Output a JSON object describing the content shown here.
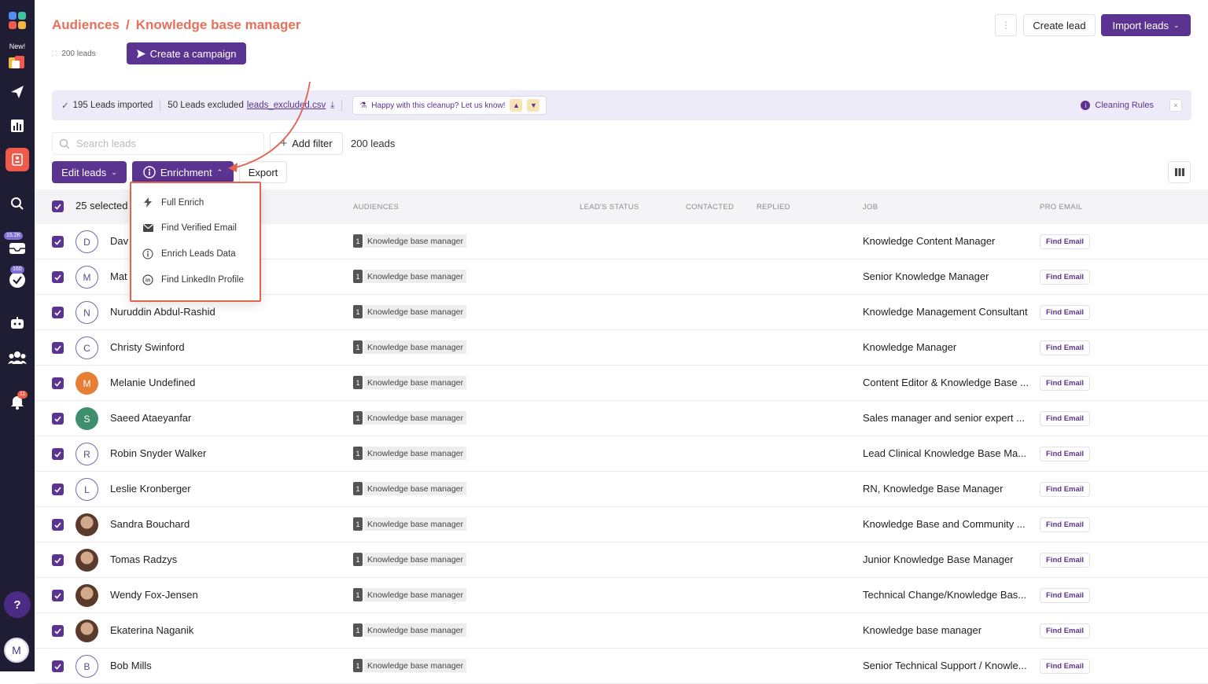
{
  "sidebar": {
    "new_label": "New!",
    "badge_inbox": "15.2K",
    "badge_tasks": "160",
    "badge_notifications": "11",
    "help_label": "?",
    "avatar_initial": "M",
    "items": [
      "logo-icon",
      "campaigns-icon",
      "paper-plane-icon",
      "analytics-icon",
      "contacts-icon",
      "search-icon",
      "inbox-icon",
      "tasks-icon",
      "robot-icon",
      "team-icon",
      "bell-icon"
    ]
  },
  "header": {
    "breadcrumb_root": "Audiences",
    "breadcrumb_sep": "/",
    "breadcrumb_current": "Knowledge base manager",
    "leads_count": "200 leads",
    "create_campaign": "Create a campaign",
    "more": "⋮",
    "create_lead": "Create lead",
    "import_leads": "Import leads"
  },
  "banner": {
    "imported": "195 Leads imported",
    "excluded": "50 Leads excluded",
    "excluded_file": "leads_excluded.csv",
    "feedback": "Happy with this cleanup? Let us know!",
    "cleaning_rules": "Cleaning Rules",
    "close": "×"
  },
  "toolbar": {
    "search_placeholder": "Search leads",
    "add_filter": "Add filter",
    "total": "200 leads",
    "edit_leads": "Edit leads",
    "enrichment": "Enrichment",
    "export": "Export"
  },
  "enrichment_menu": [
    {
      "label": "Full Enrich",
      "icon": "bolt-icon"
    },
    {
      "label": "Find Verified Email",
      "icon": "envelope-icon"
    },
    {
      "label": "Enrich Leads Data",
      "icon": "enrich-icon"
    },
    {
      "label": "Find LinkedIn Profile",
      "icon": "linkedin-icon"
    }
  ],
  "table": {
    "selected": "25 selected",
    "columns": {
      "audiences": "AUDIENCES",
      "status": "LEAD'S STATUS",
      "contacted": "CONTACTED",
      "replied": "REPLIED",
      "job": "JOB",
      "pro_email": "PRO EMAIL"
    },
    "audience_num": "1",
    "audience_tag": "Knowledge base manager",
    "find_email": "Find Email",
    "rows": [
      {
        "initial": "D",
        "name": "Dav",
        "job": "Knowledge Content Manager",
        "avatar": "outline"
      },
      {
        "initial": "M",
        "name": "Mat",
        "job": "Senior Knowledge Manager",
        "avatar": "outline"
      },
      {
        "initial": "N",
        "name": "Nuruddin Abdul-Rashid",
        "job": "Knowledge Management Consultant",
        "avatar": "outline"
      },
      {
        "initial": "C",
        "name": "Christy Swinford",
        "job": "Knowledge Manager",
        "avatar": "outline"
      },
      {
        "initial": "M",
        "name": "Melanie Undefined",
        "job": "Content Editor & Knowledge Base ...",
        "avatar": "orange"
      },
      {
        "initial": "S",
        "name": "Saeed Ataeyanfar",
        "job": "Sales manager and senior expert ...",
        "avatar": "green"
      },
      {
        "initial": "R",
        "name": "Robin Snyder Walker",
        "job": "Lead Clinical Knowledge Base Ma...",
        "avatar": "outline"
      },
      {
        "initial": "L",
        "name": "Leslie Kronberger",
        "job": "RN, Knowledge Base Manager",
        "avatar": "outline"
      },
      {
        "initial": "",
        "name": "Sandra Bouchard",
        "job": "Knowledge Base and Community ...",
        "avatar": "photo"
      },
      {
        "initial": "",
        "name": "Tomas Radzys",
        "job": "Junior Knowledge Base Manager",
        "avatar": "photo"
      },
      {
        "initial": "",
        "name": "Wendy Fox-Jensen",
        "job": "Technical Change/Knowledge Bas...",
        "avatar": "photo"
      },
      {
        "initial": "",
        "name": "Ekaterina Naganik",
        "job": "Knowledge base manager",
        "avatar": "photo"
      },
      {
        "initial": "B",
        "name": "Bob Mills",
        "job": "Senior Technical Support / Knowle...",
        "avatar": "outline"
      }
    ]
  },
  "colors": {
    "brand": "#5b3390",
    "accent": "#e8705a",
    "highlight": "#e26350"
  }
}
